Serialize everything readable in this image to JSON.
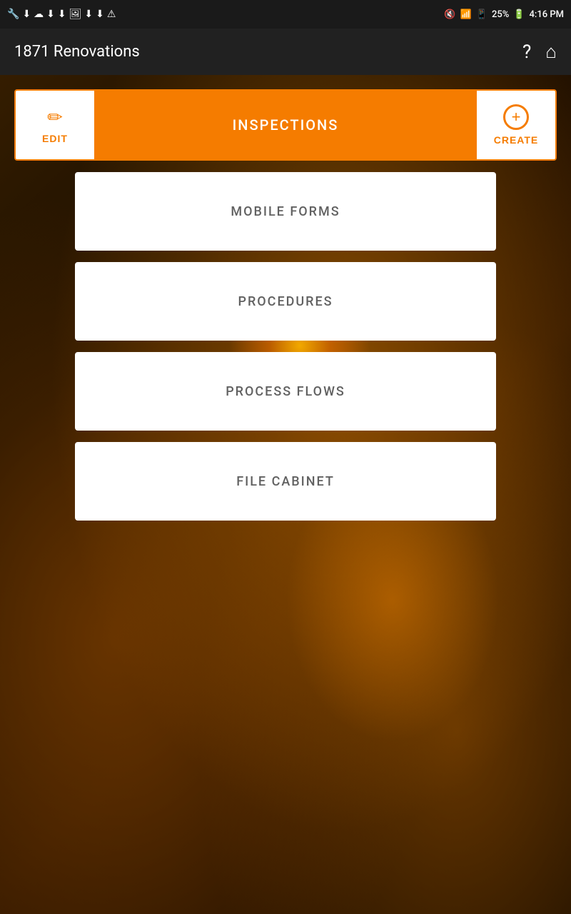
{
  "statusBar": {
    "time": "4:16 PM",
    "battery": "25%",
    "icons": [
      "🔧",
      "⬇",
      "☁",
      "⬇",
      "⬇",
      "🖼",
      "⬇",
      "⬇",
      "⚠"
    ]
  },
  "appBar": {
    "title": "1871 Renovations",
    "helpIcon": "?",
    "homeIcon": "⌂"
  },
  "headerBar": {
    "editLabel": "EDIT",
    "pageTitle": "INSPECTIONS",
    "createLabel": "CREATE"
  },
  "menuItems": [
    {
      "label": "MOBILE FORMS"
    },
    {
      "label": "PROCEDURES"
    },
    {
      "label": "PROCESS FLOWS"
    },
    {
      "label": "FILE CABINET"
    }
  ],
  "colors": {
    "orange": "#F57C00",
    "darkBg": "#212121",
    "statusBg": "#1a1a1a",
    "textGray": "#616161",
    "white": "#ffffff"
  }
}
